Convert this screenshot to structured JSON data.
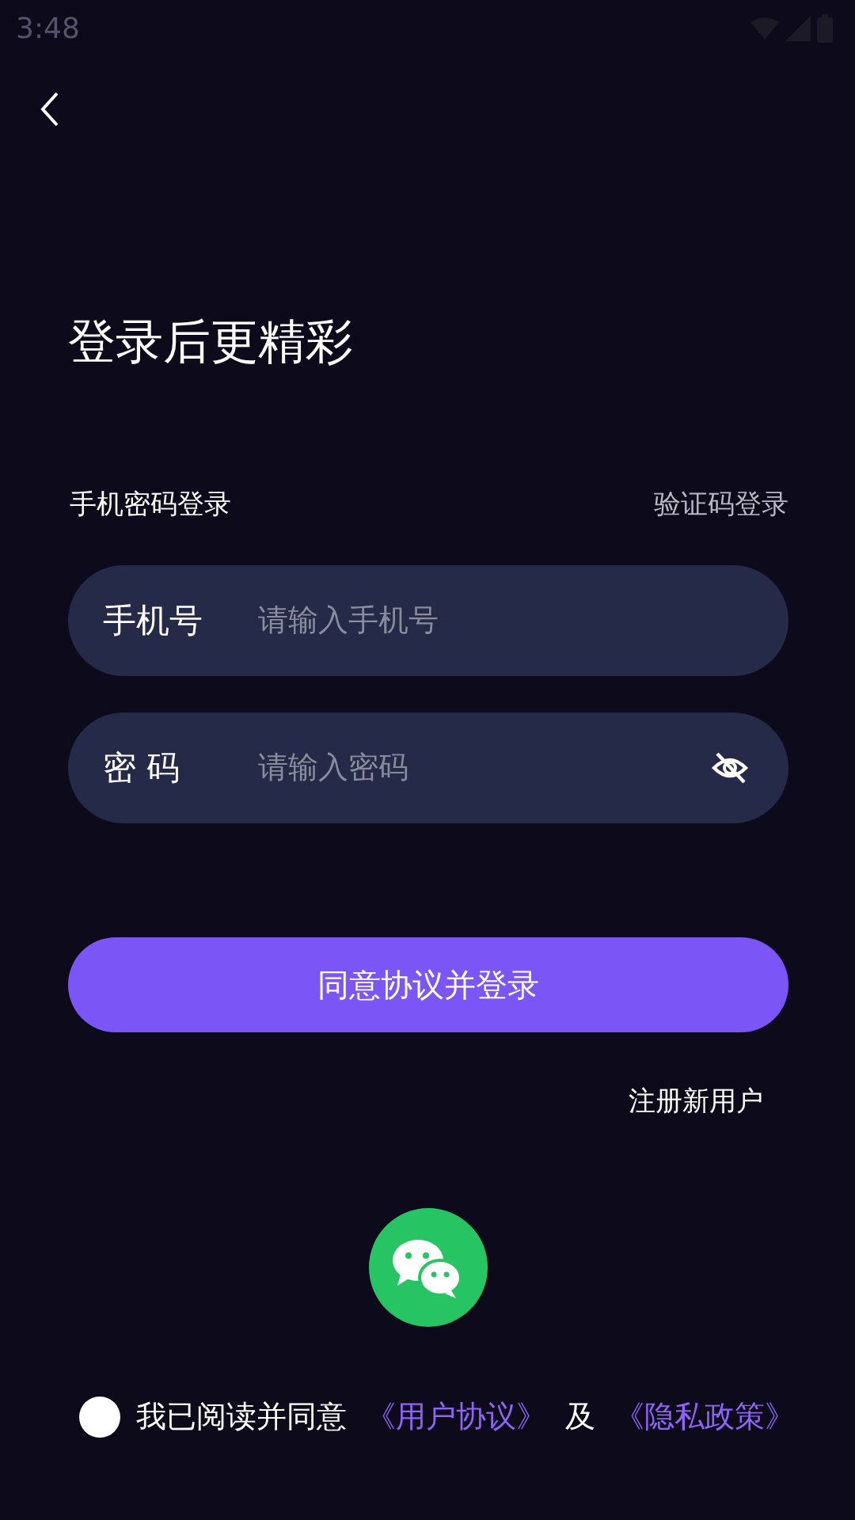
{
  "status_bar": {
    "time": "3:48"
  },
  "title": "登录后更精彩",
  "login_mode": {
    "current": "手机密码登录",
    "switch": "验证码登录"
  },
  "fields": [
    {
      "label": "手机号",
      "placeholder": "请输入手机号",
      "kind": "text"
    },
    {
      "label": "密 码",
      "placeholder": "请输入密码",
      "kind": "password"
    }
  ],
  "login_button": "同意协议并登录",
  "register_link": "注册新用户",
  "agreement": {
    "checked": false,
    "parts": [
      {
        "text": "我已阅读并同意",
        "kind": "plain"
      },
      {
        "text": "《用户协议》",
        "kind": "link"
      },
      {
        "text": "及",
        "kind": "plain"
      },
      {
        "text": "《隐私政策》",
        "kind": "link"
      }
    ]
  }
}
